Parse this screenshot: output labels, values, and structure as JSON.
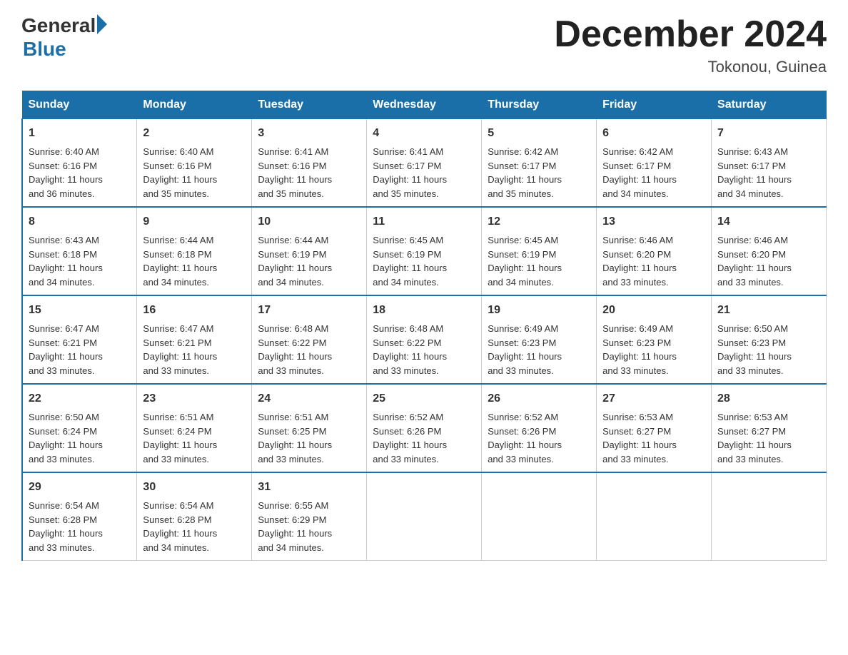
{
  "header": {
    "logo_general": "General",
    "logo_blue": "Blue",
    "month_title": "December 2024",
    "location": "Tokonou, Guinea"
  },
  "days_of_week": [
    "Sunday",
    "Monday",
    "Tuesday",
    "Wednesday",
    "Thursday",
    "Friday",
    "Saturday"
  ],
  "weeks": [
    [
      {
        "day": "1",
        "sunrise": "6:40 AM",
        "sunset": "6:16 PM",
        "daylight": "11 hours and 36 minutes."
      },
      {
        "day": "2",
        "sunrise": "6:40 AM",
        "sunset": "6:16 PM",
        "daylight": "11 hours and 35 minutes."
      },
      {
        "day": "3",
        "sunrise": "6:41 AM",
        "sunset": "6:16 PM",
        "daylight": "11 hours and 35 minutes."
      },
      {
        "day": "4",
        "sunrise": "6:41 AM",
        "sunset": "6:17 PM",
        "daylight": "11 hours and 35 minutes."
      },
      {
        "day": "5",
        "sunrise": "6:42 AM",
        "sunset": "6:17 PM",
        "daylight": "11 hours and 35 minutes."
      },
      {
        "day": "6",
        "sunrise": "6:42 AM",
        "sunset": "6:17 PM",
        "daylight": "11 hours and 34 minutes."
      },
      {
        "day": "7",
        "sunrise": "6:43 AM",
        "sunset": "6:17 PM",
        "daylight": "11 hours and 34 minutes."
      }
    ],
    [
      {
        "day": "8",
        "sunrise": "6:43 AM",
        "sunset": "6:18 PM",
        "daylight": "11 hours and 34 minutes."
      },
      {
        "day": "9",
        "sunrise": "6:44 AM",
        "sunset": "6:18 PM",
        "daylight": "11 hours and 34 minutes."
      },
      {
        "day": "10",
        "sunrise": "6:44 AM",
        "sunset": "6:19 PM",
        "daylight": "11 hours and 34 minutes."
      },
      {
        "day": "11",
        "sunrise": "6:45 AM",
        "sunset": "6:19 PM",
        "daylight": "11 hours and 34 minutes."
      },
      {
        "day": "12",
        "sunrise": "6:45 AM",
        "sunset": "6:19 PM",
        "daylight": "11 hours and 34 minutes."
      },
      {
        "day": "13",
        "sunrise": "6:46 AM",
        "sunset": "6:20 PM",
        "daylight": "11 hours and 33 minutes."
      },
      {
        "day": "14",
        "sunrise": "6:46 AM",
        "sunset": "6:20 PM",
        "daylight": "11 hours and 33 minutes."
      }
    ],
    [
      {
        "day": "15",
        "sunrise": "6:47 AM",
        "sunset": "6:21 PM",
        "daylight": "11 hours and 33 minutes."
      },
      {
        "day": "16",
        "sunrise": "6:47 AM",
        "sunset": "6:21 PM",
        "daylight": "11 hours and 33 minutes."
      },
      {
        "day": "17",
        "sunrise": "6:48 AM",
        "sunset": "6:22 PM",
        "daylight": "11 hours and 33 minutes."
      },
      {
        "day": "18",
        "sunrise": "6:48 AM",
        "sunset": "6:22 PM",
        "daylight": "11 hours and 33 minutes."
      },
      {
        "day": "19",
        "sunrise": "6:49 AM",
        "sunset": "6:23 PM",
        "daylight": "11 hours and 33 minutes."
      },
      {
        "day": "20",
        "sunrise": "6:49 AM",
        "sunset": "6:23 PM",
        "daylight": "11 hours and 33 minutes."
      },
      {
        "day": "21",
        "sunrise": "6:50 AM",
        "sunset": "6:23 PM",
        "daylight": "11 hours and 33 minutes."
      }
    ],
    [
      {
        "day": "22",
        "sunrise": "6:50 AM",
        "sunset": "6:24 PM",
        "daylight": "11 hours and 33 minutes."
      },
      {
        "day": "23",
        "sunrise": "6:51 AM",
        "sunset": "6:24 PM",
        "daylight": "11 hours and 33 minutes."
      },
      {
        "day": "24",
        "sunrise": "6:51 AM",
        "sunset": "6:25 PM",
        "daylight": "11 hours and 33 minutes."
      },
      {
        "day": "25",
        "sunrise": "6:52 AM",
        "sunset": "6:26 PM",
        "daylight": "11 hours and 33 minutes."
      },
      {
        "day": "26",
        "sunrise": "6:52 AM",
        "sunset": "6:26 PM",
        "daylight": "11 hours and 33 minutes."
      },
      {
        "day": "27",
        "sunrise": "6:53 AM",
        "sunset": "6:27 PM",
        "daylight": "11 hours and 33 minutes."
      },
      {
        "day": "28",
        "sunrise": "6:53 AM",
        "sunset": "6:27 PM",
        "daylight": "11 hours and 33 minutes."
      }
    ],
    [
      {
        "day": "29",
        "sunrise": "6:54 AM",
        "sunset": "6:28 PM",
        "daylight": "11 hours and 33 minutes."
      },
      {
        "day": "30",
        "sunrise": "6:54 AM",
        "sunset": "6:28 PM",
        "daylight": "11 hours and 34 minutes."
      },
      {
        "day": "31",
        "sunrise": "6:55 AM",
        "sunset": "6:29 PM",
        "daylight": "11 hours and 34 minutes."
      },
      null,
      null,
      null,
      null
    ]
  ]
}
